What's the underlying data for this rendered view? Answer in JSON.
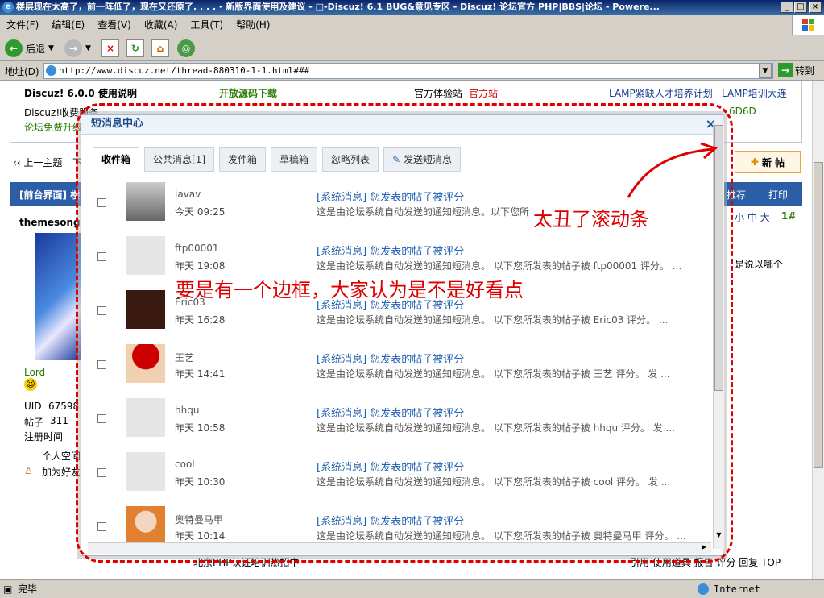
{
  "window": {
    "title": "楼层现在太高了，前一阵低了，现在又还原了. . . . - 新版界面使用及建议 - □-Discuz! 6.1 BUG&意见专区 - Discuz! 论坛官方 PHP|BBS|论坛 - Powere..."
  },
  "menu": [
    "文件(F)",
    "编辑(E)",
    "查看(V)",
    "收藏(A)",
    "工具(T)",
    "帮助(H)"
  ],
  "toolbar": {
    "back": "后退"
  },
  "address": {
    "label": "地址(D)",
    "url": "http://www.discuz.net/thread-880310-1-1.html###",
    "go": "转到"
  },
  "page": {
    "top_links": {
      "usage": "Discuz! 6.0.0 使用说明",
      "opensource": "开放源码下载",
      "trial": "官方体验站",
      "official": "官方站",
      "lamp1": "LAMP紧缺人才培养计划",
      "lamp2": "LAMP培训大连",
      "discuz_paid": "Discuz!收费服务",
      "upgrade": "论坛免费升级",
      "hex": "6D6D"
    },
    "prev_topic": "‹‹ 上一主题",
    "prev_short": "下",
    "new_post": "新 帖",
    "thread_head": "[前台界面] 楼",
    "recommend": "推荐",
    "print": "打印",
    "font_size": "小 中 大",
    "floor": "1#",
    "author": "themesong",
    "user": {
      "name": "Lord",
      "uid_label": "UID",
      "uid": "67598",
      "posts_label": "帖子",
      "posts": "311",
      "reg_label": "注册时间",
      "space": "个人空间",
      "add_friend": "加为好友"
    },
    "side_text": "是说以哪个",
    "bottom_ad": "北京PHP认证培训热招中",
    "bottom_links": "引用 使用道具 报告 评分 回复 TOP"
  },
  "modal": {
    "title": "短消息中心",
    "close": "×",
    "tabs": [
      "收件箱",
      "公共消息[1]",
      "发件箱",
      "草稿箱",
      "忽略列表",
      "发送短消息"
    ],
    "messages": [
      {
        "user": "iavav",
        "time": "今天 09:25",
        "subject": "[系统消息] 您发表的帖子被评分",
        "snippet": "这是由论坛系统自动发送的通知短消息。以下您所"
      },
      {
        "user": "ftp00001",
        "time": "昨天 19:08",
        "subject": "[系统消息] 您发表的帖子被评分",
        "snippet": "这是由论坛系统自动发送的通知短消息。 以下您所发表的帖子被 ftp00001 评分。 ..."
      },
      {
        "user": "Eric03",
        "time": "昨天 16:28",
        "subject": "[系统消息] 您发表的帖子被评分",
        "snippet": "这是由论坛系统自动发送的通知短消息。 以下您所发表的帖子被 Eric03 评分。 ..."
      },
      {
        "user": "王艺",
        "time": "昨天 14:41",
        "subject": "[系统消息] 您发表的帖子被评分",
        "snippet": "这是由论坛系统自动发送的通知短消息。 以下您所发表的帖子被 王艺 评分。 发 ..."
      },
      {
        "user": "hhqu",
        "time": "昨天 10:58",
        "subject": "[系统消息] 您发表的帖子被评分",
        "snippet": "这是由论坛系统自动发送的通知短消息。 以下您所发表的帖子被 hhqu 评分。 发 ..."
      },
      {
        "user": "cool",
        "time": "昨天 10:30",
        "subject": "[系统消息] 您发表的帖子被评分",
        "snippet": "这是由论坛系统自动发送的通知短消息。 以下您所发表的帖子被 cool 评分。 发 ..."
      },
      {
        "user": "奥特曼马甲",
        "time": "昨天 10:14",
        "subject": "[系统消息] 您发表的帖子被评分",
        "snippet": "这是由论坛系统自动发送的通知短消息。 以下您所发表的帖子被 奥特曼马甲 评分。 ..."
      }
    ]
  },
  "annotations": {
    "a1": "太丑了滚动条",
    "a2": "要是有一个边框，大家认为是不是好看点"
  },
  "status": {
    "left": "完毕",
    "zone": "Internet"
  },
  "colors": {
    "title_bar": "#0a246a",
    "annotation": "#d00000",
    "link": "#2060b0"
  }
}
